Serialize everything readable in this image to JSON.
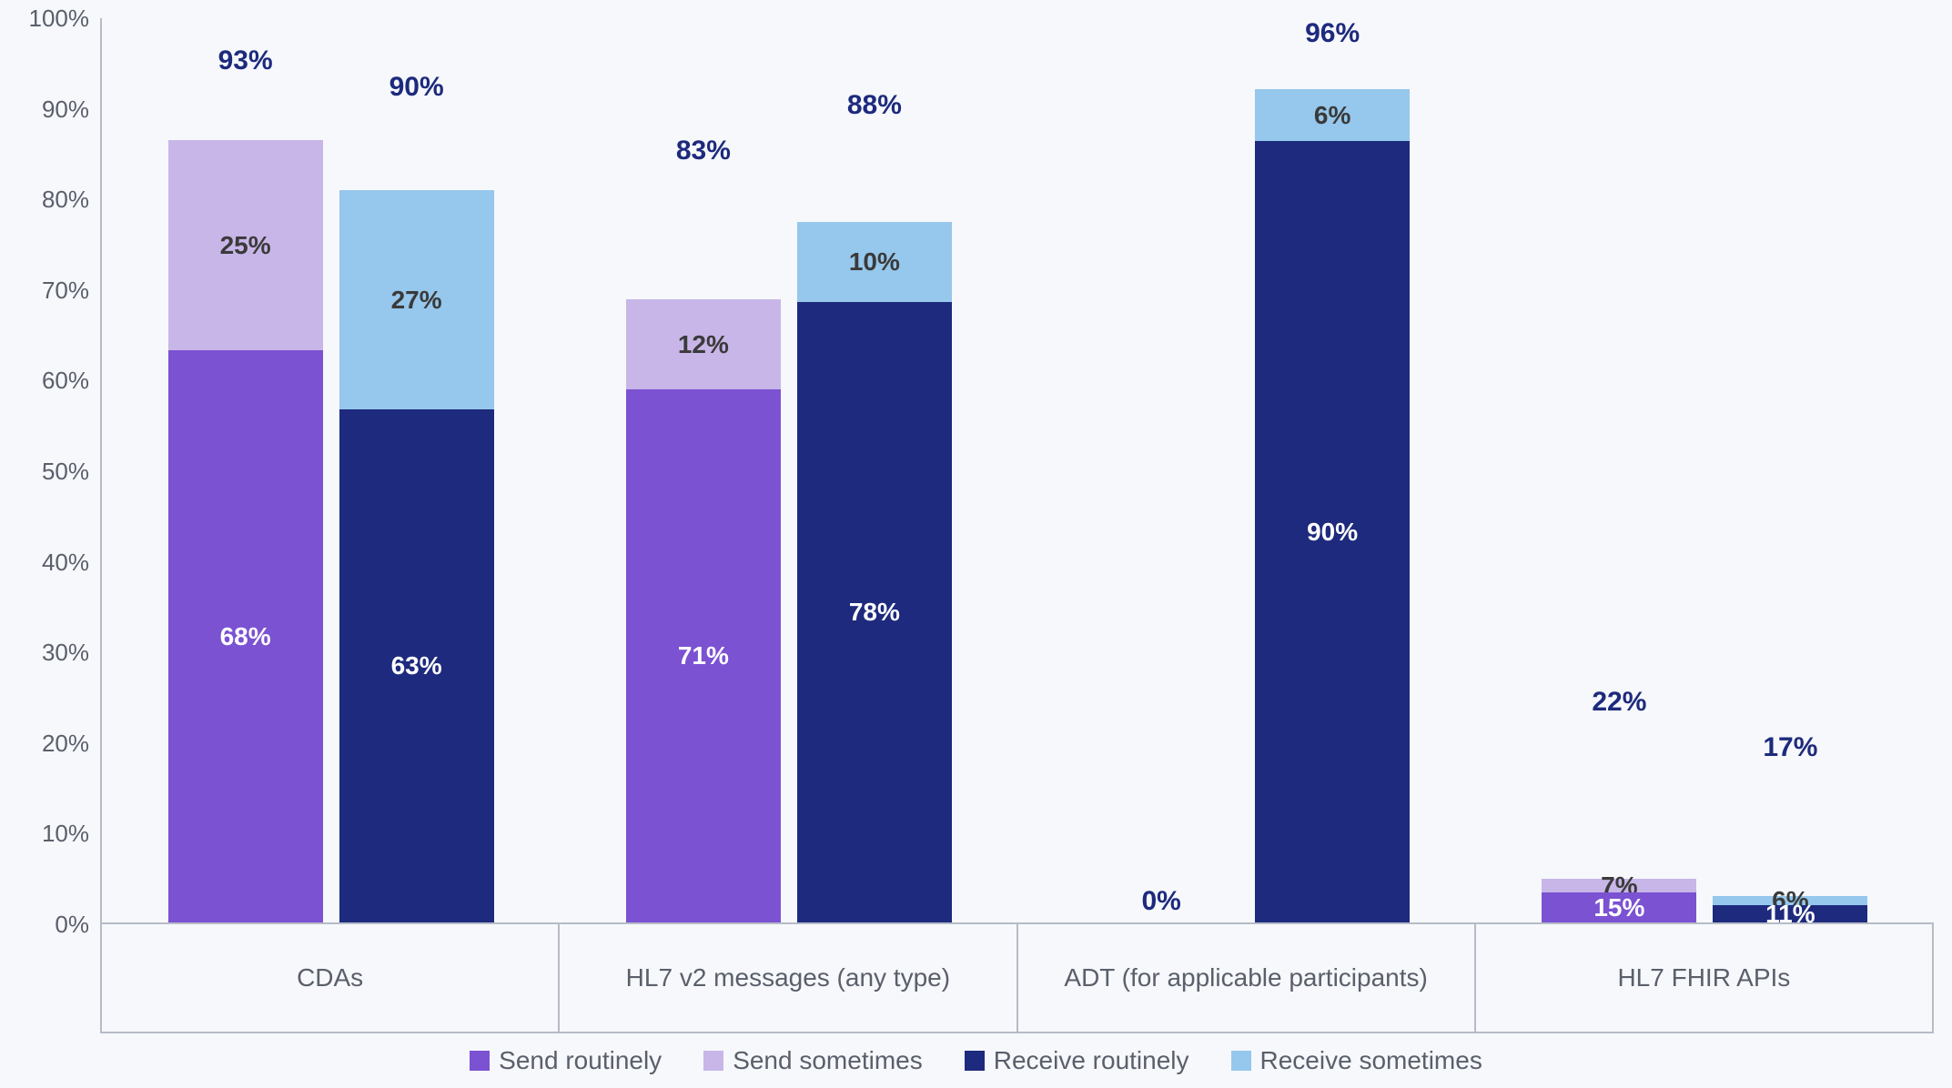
{
  "chart_data": {
    "type": "bar",
    "stacked": true,
    "ylabel": "",
    "xlabel": "",
    "ylim": [
      0,
      100
    ],
    "y_ticks": [
      100,
      90,
      80,
      70,
      60,
      50,
      40,
      30,
      20,
      10,
      0
    ],
    "y_tick_suffix": "%",
    "categories": [
      "CDAs",
      "HL7 v2 messages (any type)",
      "ADT (for applicable participants)",
      "HL7 FHIR APIs"
    ],
    "subgroups": [
      "Send",
      "Receive"
    ],
    "series": [
      {
        "name": "Send routinely",
        "color": "#7b52d1",
        "subgroup": "Send",
        "values": [
          68,
          71,
          0,
          15
        ]
      },
      {
        "name": "Send sometimes",
        "color": "#c8b6e8",
        "subgroup": "Send",
        "values": [
          25,
          12,
          0,
          7
        ]
      },
      {
        "name": "Receive routinely",
        "color": "#1d2a7d",
        "subgroup": "Receive",
        "values": [
          63,
          78,
          90,
          11
        ]
      },
      {
        "name": "Receive sometimes",
        "color": "#96c7ec",
        "subgroup": "Receive",
        "values": [
          27,
          10,
          6,
          6
        ]
      }
    ],
    "totals": {
      "Send": [
        93,
        83,
        0,
        22
      ],
      "Receive": [
        90,
        88,
        96,
        17
      ]
    },
    "value_suffix": "%"
  },
  "legend": [
    "Send routinely",
    "Send sometimes",
    "Receive routinely",
    "Receive sometimes"
  ]
}
